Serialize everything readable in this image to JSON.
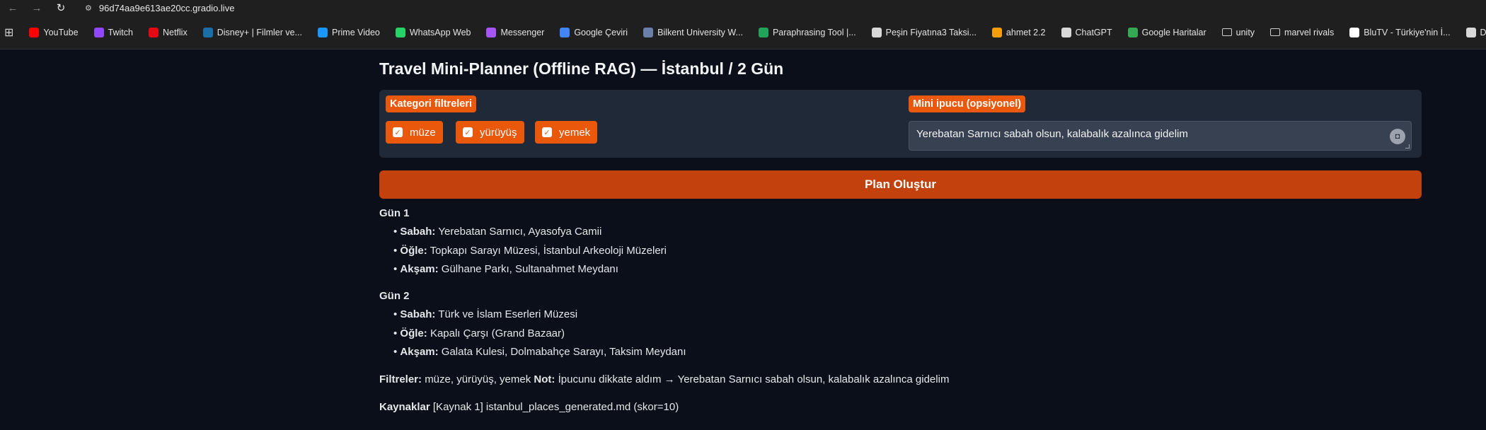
{
  "browser": {
    "url": "96d74aa9e613ae20cc.gradio.live",
    "bookmarks": [
      {
        "label": "YouTube",
        "icon": "youtube-icon",
        "color": "#ff0000"
      },
      {
        "label": "Twitch",
        "icon": "twitch-icon",
        "color": "#9146ff"
      },
      {
        "label": "Netflix",
        "icon": "netflix-icon",
        "color": "#e50914"
      },
      {
        "label": "Disney+ | Filmler ve...",
        "icon": "disney-icon",
        "color": "#1b6fa8"
      },
      {
        "label": "Prime Video",
        "icon": "prime-video-icon",
        "color": "#1a98ff"
      },
      {
        "label": "WhatsApp Web",
        "icon": "whatsapp-icon",
        "color": "#25d366"
      },
      {
        "label": "Messenger",
        "icon": "messenger-icon",
        "color": "#a855f7"
      },
      {
        "label": "Google Çeviri",
        "icon": "google-translate-icon",
        "color": "#4285f4"
      },
      {
        "label": "Bilkent University W...",
        "icon": "bilkent-icon",
        "color": "#6b7fa8"
      },
      {
        "label": "Paraphrasing Tool |...",
        "icon": "paraphrasing-icon",
        "color": "#22a35a"
      },
      {
        "label": "Peşin Fiyatına3 Taksi...",
        "icon": "globe-icon",
        "color": "#d9d9d9"
      },
      {
        "label": "ahmet 2.2",
        "icon": "ahmet-icon",
        "color": "#f59e0b"
      },
      {
        "label": "ChatGPT",
        "icon": "chatgpt-icon",
        "color": "#d9d9d9"
      },
      {
        "label": "Google Haritalar",
        "icon": "google-maps-icon",
        "color": "#34a853"
      },
      {
        "label": "unity",
        "icon": "folder-icon",
        "color": "#cfcfcf"
      },
      {
        "label": "marvel rivals",
        "icon": "folder-icon",
        "color": "#cfcfcf"
      },
      {
        "label": "BluTV - Türkiye'nin İ...",
        "icon": "blutv-icon",
        "color": "#ffffff"
      },
      {
        "label": "Decks - Pokémon T...",
        "icon": "pokemon-icon",
        "color": "#d9d9d9"
      }
    ]
  },
  "app": {
    "title": "Travel Mini-Planner (Offline RAG) — İstanbul / 2 Gün",
    "filters": {
      "label": "Kategori filtreleri",
      "options": [
        {
          "label": "müze",
          "checked": true
        },
        {
          "label": "yürüyüş",
          "checked": true
        },
        {
          "label": "yemek",
          "checked": true
        }
      ]
    },
    "tip": {
      "label": "Mini ipucu (opsiyonel)",
      "value": "Yerebatan Sarnıcı sabah olsun, kalabalık azalınca gidelim"
    },
    "button_label": "Plan Oluştur",
    "output": {
      "days": [
        {
          "title": "Gün 1",
          "items": [
            {
              "label": "Sabah:",
              "text": "Yerebatan Sarnıcı, Ayasofya Camii"
            },
            {
              "label": "Öğle:",
              "text": "Topkapı Sarayı Müzesi, İstanbul Arkeoloji Müzeleri"
            },
            {
              "label": "Akşam:",
              "text": "Gülhane Parkı, Sultanahmet Meydanı"
            }
          ]
        },
        {
          "title": "Gün 2",
          "items": [
            {
              "label": "Sabah:",
              "text": "Türk ve İslam Eserleri Müzesi"
            },
            {
              "label": "Öğle:",
              "text": "Kapalı Çarşı (Grand Bazaar)"
            },
            {
              "label": "Akşam:",
              "text": "Galata Kulesi, Dolmabahçe Sarayı, Taksim Meydanı"
            }
          ]
        }
      ],
      "filters_label": "Filtreler:",
      "filters_text": "müze, yürüyüş, yemek",
      "note_label": "Not:",
      "note_text": "İpucunu dikkate aldım → Yerebatan Sarnıcı sabah olsun, kalabalık azalınca gidelim",
      "sources_label": "Kaynaklar",
      "sources_text": "[Kaynak 1] istanbul_places_generated.md (skor=10)"
    }
  }
}
